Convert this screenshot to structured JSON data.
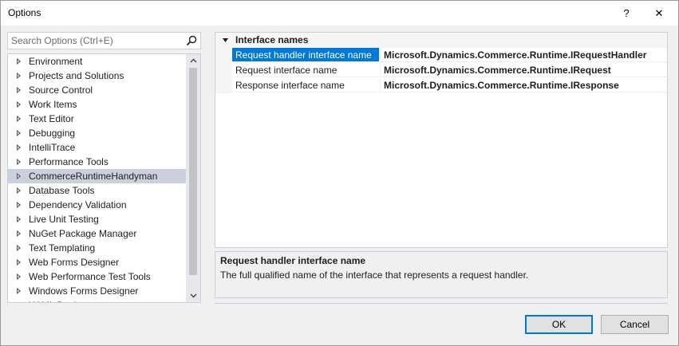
{
  "window": {
    "title": "Options",
    "help_glyph": "?",
    "close_glyph": "✕"
  },
  "search": {
    "placeholder": "Search Options (Ctrl+E)",
    "value": ""
  },
  "tree": {
    "items": [
      {
        "label": "Environment",
        "selected": false
      },
      {
        "label": "Projects and Solutions",
        "selected": false
      },
      {
        "label": "Source Control",
        "selected": false
      },
      {
        "label": "Work Items",
        "selected": false
      },
      {
        "label": "Text Editor",
        "selected": false
      },
      {
        "label": "Debugging",
        "selected": false
      },
      {
        "label": "IntelliTrace",
        "selected": false
      },
      {
        "label": "Performance Tools",
        "selected": false
      },
      {
        "label": "CommerceRuntimeHandyman",
        "selected": true
      },
      {
        "label": "Database Tools",
        "selected": false
      },
      {
        "label": "Dependency Validation",
        "selected": false
      },
      {
        "label": "Live Unit Testing",
        "selected": false
      },
      {
        "label": "NuGet Package Manager",
        "selected": false
      },
      {
        "label": "Text Templating",
        "selected": false
      },
      {
        "label": "Web Forms Designer",
        "selected": false
      },
      {
        "label": "Web Performance Test Tools",
        "selected": false
      },
      {
        "label": "Windows Forms Designer",
        "selected": false
      },
      {
        "label": "XAML Designer",
        "selected": false
      }
    ]
  },
  "property_grid": {
    "category": "Interface names",
    "rows": [
      {
        "name": "Request handler interface name",
        "value": "Microsoft.Dynamics.Commerce.Runtime.IRequestHandler",
        "selected": true
      },
      {
        "name": "Request interface name",
        "value": "Microsoft.Dynamics.Commerce.Runtime.IRequest",
        "selected": false
      },
      {
        "name": "Response interface name",
        "value": "Microsoft.Dynamics.Commerce.Runtime.IResponse",
        "selected": false
      }
    ]
  },
  "description": {
    "title": "Request handler interface name",
    "text": "The full qualified name of the interface that represents a request handler."
  },
  "buttons": {
    "ok": "OK",
    "cancel": "Cancel"
  },
  "colors": {
    "selection_accent": "#0078d7",
    "tree_selected": "#ccd0dc"
  }
}
